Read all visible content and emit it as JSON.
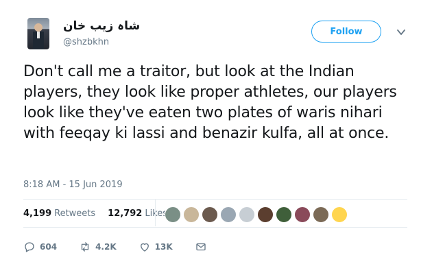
{
  "author": {
    "display_name": "شاہ زیب خان",
    "handle": "@shzbkhn",
    "avatar_icon": "profile-photo"
  },
  "follow_button": {
    "label": "Follow",
    "color": "#1da1f2"
  },
  "more_menu_icon": "chevron-down-icon",
  "tweet": {
    "text": "Don't call me a traitor, but look at the Indian players, they look like proper athletes, our players look like they've eaten two plates of waris nihari with feeqay ki lassi and benazir kulfa, all at once.",
    "timestamp": "8:18 AM - 15 Jun 2019"
  },
  "stats": {
    "retweets_count": "4,199",
    "retweets_label": "Retweets",
    "likes_count": "12,792",
    "likes_label": "Likes"
  },
  "likers": [
    {
      "color": "#7a8f86"
    },
    {
      "color": "#c9b79a"
    },
    {
      "color": "#6b5a4e"
    },
    {
      "color": "#9aa7b3"
    },
    {
      "color": "#c7ced4"
    },
    {
      "color": "#5b3e2f"
    },
    {
      "color": "#3f5f3a"
    },
    {
      "color": "#8a4a5a"
    },
    {
      "color": "#7b6a56"
    },
    {
      "color": "#ffd54f"
    }
  ],
  "actions": {
    "reply_count": "604",
    "retweet_count": "4.2K",
    "like_count": "13K",
    "reply_icon": "reply-icon",
    "retweet_icon": "retweet-icon",
    "like_icon": "heart-icon",
    "dm_icon": "envelope-icon"
  }
}
